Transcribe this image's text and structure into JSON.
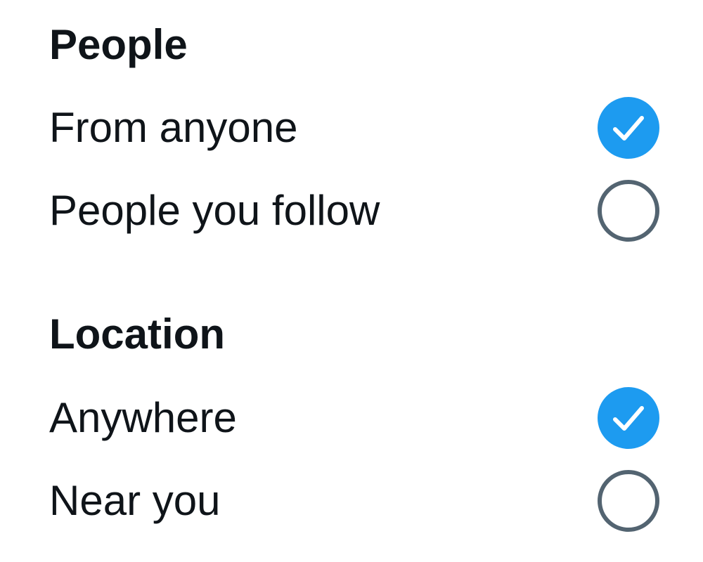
{
  "sections": [
    {
      "title": "People",
      "options": [
        {
          "label": "From anyone",
          "checked": true
        },
        {
          "label": "People you follow",
          "checked": false
        }
      ]
    },
    {
      "title": "Location",
      "options": [
        {
          "label": "Anywhere",
          "checked": true
        },
        {
          "label": "Near you",
          "checked": false
        }
      ]
    }
  ],
  "colors": {
    "accent": "#1d9bf0",
    "text": "#0f1419",
    "radio_border": "#536471"
  }
}
